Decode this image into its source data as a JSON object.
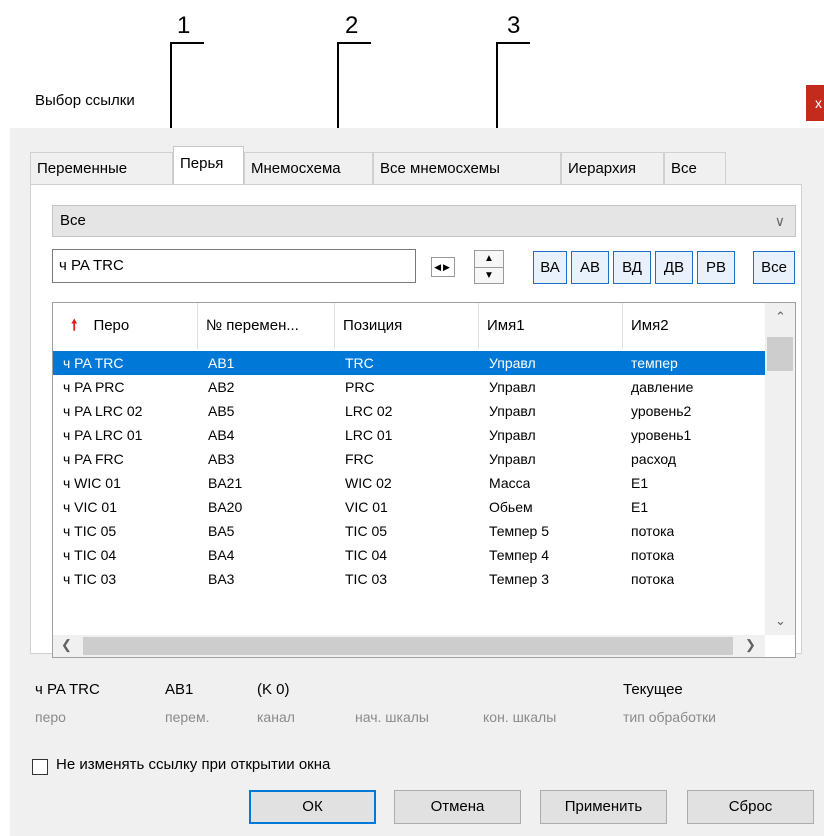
{
  "callouts": [
    "1",
    "2",
    "3"
  ],
  "dialog": {
    "title": "Выбор ссылки",
    "close": "x"
  },
  "tabs": [
    "Переменные",
    "Перья",
    "Мнемосхема",
    "Все мнемосхемы",
    "Иерархия",
    "Все"
  ],
  "active_tab": "Перья",
  "filter_combo": {
    "value": "Все"
  },
  "pen_input": {
    "value": "ч PA TRC"
  },
  "scope_buttons": [
    "ВА",
    "АВ",
    "ВД",
    "ДВ",
    "РВ",
    "Все"
  ],
  "table": {
    "sort_icon_color": "#e02020",
    "columns": [
      "Перо",
      "№ перемен...",
      "Позиция",
      "Имя1",
      "Имя2"
    ],
    "rows": [
      [
        "ч PA TRC",
        "AB1",
        "TRC",
        "Управл",
        "темпер"
      ],
      [
        "ч PA PRC",
        "AB2",
        "PRC",
        "Управл",
        "давление"
      ],
      [
        "ч PA LRC 02",
        "AB5",
        "LRC 02",
        "Управл",
        "уровень2"
      ],
      [
        "ч PA LRC 01",
        "AB4",
        "LRC 01",
        "Управл",
        "уровень1"
      ],
      [
        "ч PA FRC",
        "AB3",
        "FRC",
        "Управл",
        "расход"
      ],
      [
        "ч WIC 01",
        "BA21",
        "WIC 02",
        "Масса",
        "E1"
      ],
      [
        "ч VIC 01",
        "BA20",
        "VIC 01",
        "Обьем",
        "E1"
      ],
      [
        "ч TIC 05",
        "BA5",
        "TIC 05",
        "Темпер 5",
        "потока"
      ],
      [
        "ч TIC 04",
        "BA4",
        "TIC 04",
        "Темпер 4",
        "потока"
      ],
      [
        "ч TIC 03",
        "BA3",
        "TIC 03",
        "Темпер 3",
        "потока"
      ]
    ],
    "selected_row": 0
  },
  "info": {
    "values": {
      "pen": "ч PA TRC",
      "var": "AB1",
      "channel": "(K 0)",
      "processing": "Текущее"
    },
    "captions": {
      "pen": "перо",
      "var": "перем.",
      "channel": "канал",
      "scale_start": "нач. шкалы",
      "scale_end": "кон. шкалы",
      "processing": "тип обработки"
    }
  },
  "checkbox": {
    "label": "Не изменять ссылку при открытии окна",
    "checked": false
  },
  "buttons": {
    "ok": "ОК",
    "cancel": "Отмена",
    "apply": "Применить",
    "reset": "Сброс"
  },
  "colors": {
    "selection": "#0078d7",
    "scope_button_border": "#1e6fc8",
    "close": "#c42b1c"
  }
}
